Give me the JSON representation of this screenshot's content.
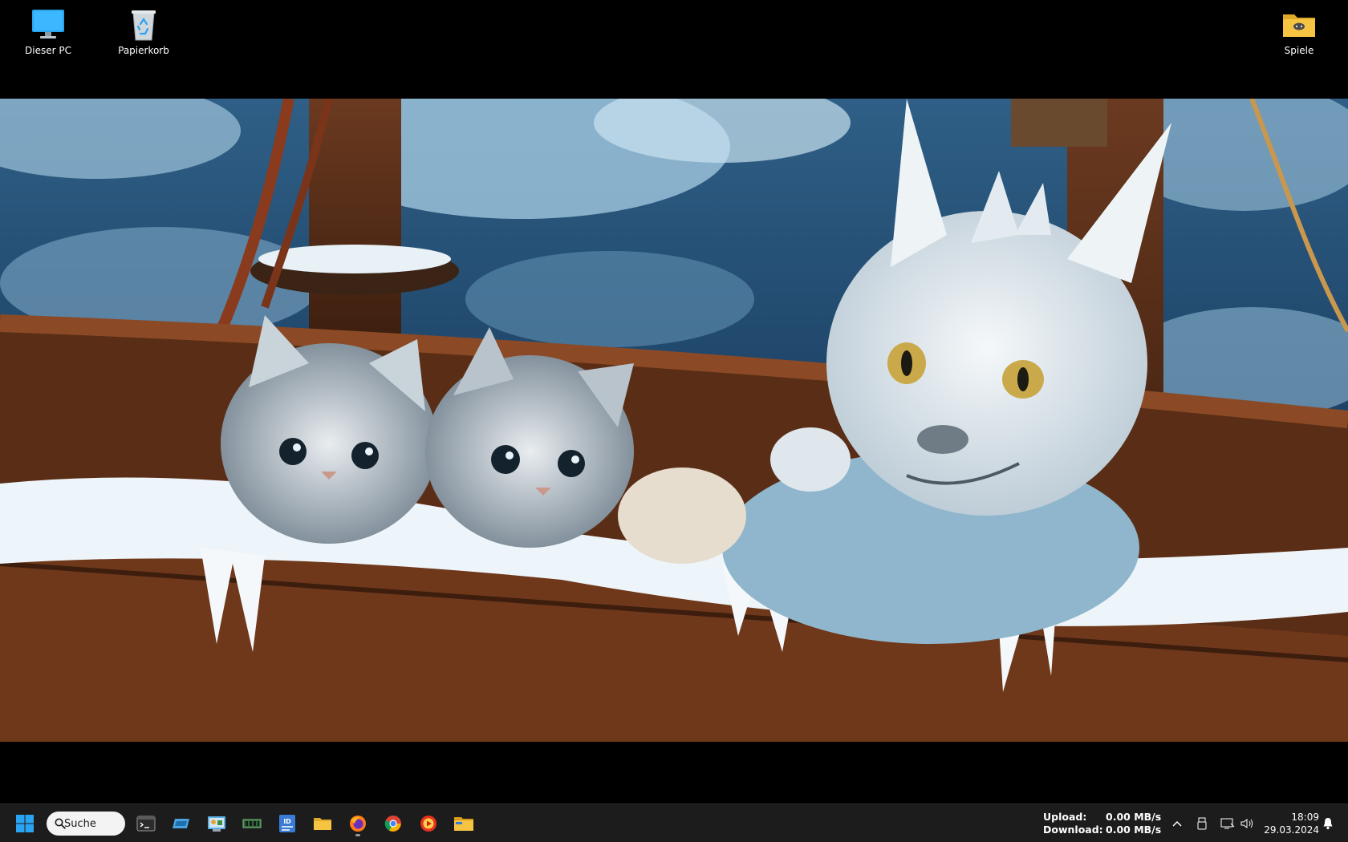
{
  "desktop_icons": [
    {
      "label": "Dieser PC",
      "icon": "monitor-icon"
    },
    {
      "label": "Papierkorb",
      "icon": "recycle-bin-icon"
    },
    {
      "label": "Spiele",
      "icon": "folder-games-icon"
    }
  ],
  "taskbar": {
    "search_label": "Suche",
    "apps": [
      {
        "name": "terminal",
        "icon": "terminal-icon"
      },
      {
        "name": "drive",
        "icon": "drive-icon"
      },
      {
        "name": "control-panel",
        "icon": "control-panel-icon"
      },
      {
        "name": "ram-monitor",
        "icon": "memory-icon"
      },
      {
        "name": "id-app",
        "icon": "id-card-icon"
      },
      {
        "name": "explorer",
        "icon": "folder-icon"
      },
      {
        "name": "firefox",
        "icon": "firefox-icon"
      },
      {
        "name": "chrome",
        "icon": "chrome-icon"
      },
      {
        "name": "media-player",
        "icon": "play-icon"
      },
      {
        "name": "file-manager",
        "icon": "folder-yellow-icon"
      }
    ]
  },
  "network": {
    "upload_label": "Upload:",
    "upload_value": "0.00 MB/s",
    "download_label": "Download:",
    "download_value": "0.00 MB/s"
  },
  "clock": {
    "time": "18:09",
    "date": "29.03.2024"
  },
  "colors": {
    "taskbar_bg": "#1c1c1c",
    "windows_blue": "#2aa3f0",
    "folder_yellow": "#f6c443"
  }
}
